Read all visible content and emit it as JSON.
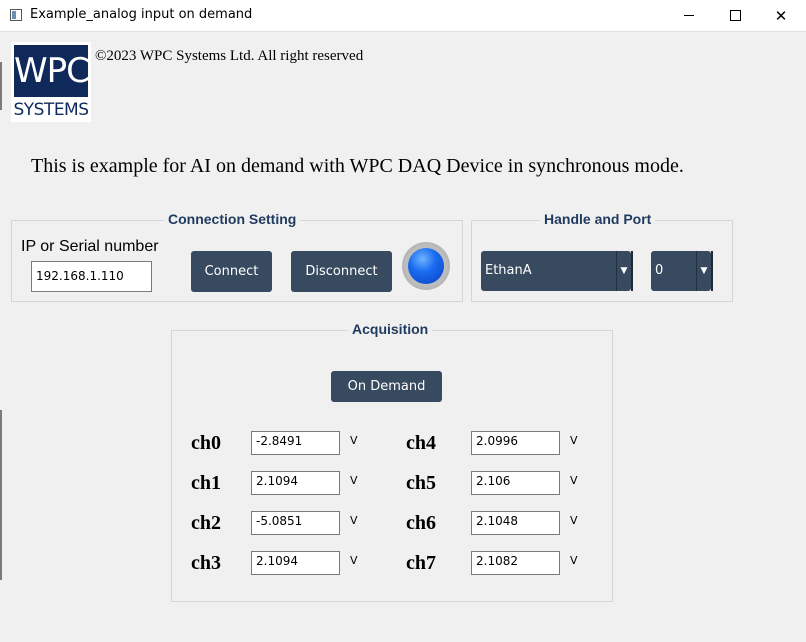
{
  "window": {
    "title": "Example_analog input on demand",
    "controls": {
      "minimize": "—",
      "maximize": "☐",
      "close": "✕"
    }
  },
  "logo": {
    "top": "WPC",
    "bottom": "SYSTEMS"
  },
  "copyright": "©2023 WPC Systems Ltd. All right reserved",
  "intro": "This is example for AI on demand with WPC DAQ Device in synchronous mode.",
  "connection": {
    "title": "Connection Setting",
    "ip_label": "IP or Serial number",
    "ip_value": "192.168.1.110",
    "connect_label": "Connect",
    "disconnect_label": "Disconnect",
    "led_color": "#1a6cf0"
  },
  "handle_port": {
    "title": "Handle and Port",
    "handle_value": "EthanA",
    "port_value": "0"
  },
  "acquisition": {
    "title": "Acquisition",
    "on_demand_label": "On Demand",
    "unit": "V",
    "channels": [
      {
        "label": "ch0",
        "value": "-2.8491"
      },
      {
        "label": "ch1",
        "value": "2.1094"
      },
      {
        "label": "ch2",
        "value": "-5.0851"
      },
      {
        "label": "ch3",
        "value": "2.1094"
      },
      {
        "label": "ch4",
        "value": "2.0996"
      },
      {
        "label": "ch5",
        "value": "2.106"
      },
      {
        "label": "ch6",
        "value": "2.1048"
      },
      {
        "label": "ch7",
        "value": "2.1082"
      }
    ]
  },
  "colors": {
    "accent_button": "#374a5f",
    "group_title": "#1f3a5f",
    "logo_blue": "#0f2a5a"
  }
}
